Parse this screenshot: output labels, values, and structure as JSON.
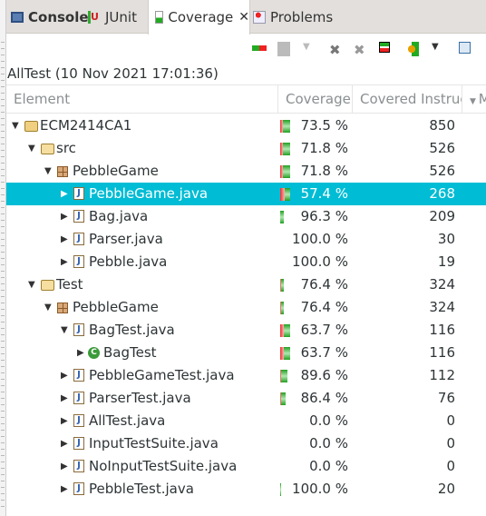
{
  "tabs": [
    {
      "label": "Console",
      "icon": "console-icon",
      "bold": true
    },
    {
      "label": "JUnit",
      "icon": "junit-icon"
    },
    {
      "label": "Coverage",
      "icon": "coverage-icon",
      "active": true,
      "closable": true
    },
    {
      "label": "Problems",
      "icon": "problems-icon"
    }
  ],
  "toolbar": [
    "link-icon",
    "merge-sessions-icon",
    "dropdown-icon",
    "remove-session-icon",
    "remove-all-sessions-icon",
    "dump-execution-data-icon",
    "coverage-run-icon",
    "view-menu-icon",
    "collapse-all-icon"
  ],
  "session_title": "AllTest (10 Nov 2021 17:01:36)",
  "columns": [
    "Element",
    "Coverage",
    "Covered Instruct",
    "Missed"
  ],
  "colors": {
    "selection": "#00bcd4",
    "covered": "#22b022",
    "missed": "#e83030"
  },
  "rows": [
    {
      "name": "ECM2414CA1",
      "type": "project",
      "level": 0,
      "expanded": true,
      "coverage": "73.5 %",
      "covered": "850",
      "pct": 73.5,
      "bar": 1
    },
    {
      "name": "src",
      "type": "source-folder",
      "level": 1,
      "expanded": true,
      "coverage": "71.8 %",
      "covered": "526",
      "pct": 71.8,
      "bar": 1
    },
    {
      "name": "PebbleGame",
      "type": "package",
      "level": 2,
      "expanded": true,
      "coverage": "71.8 %",
      "covered": "526",
      "pct": 71.8,
      "bar": 1
    },
    {
      "name": "PebbleGame.java",
      "type": "java-file",
      "level": 3,
      "expanded": false,
      "coverage": "57.4 %",
      "covered": "268",
      "pct": 57.4,
      "bar": 1,
      "selected": true
    },
    {
      "name": "Bag.java",
      "type": "java-file",
      "level": 3,
      "expanded": false,
      "coverage": "96.3 %",
      "covered": "209",
      "pct": 96.3,
      "bar": 0.4
    },
    {
      "name": "Parser.java",
      "type": "java-file",
      "level": 3,
      "expanded": false,
      "coverage": "100.0 %",
      "covered": "30",
      "pct": 100,
      "bar": 0
    },
    {
      "name": "Pebble.java",
      "type": "java-file",
      "level": 3,
      "expanded": false,
      "coverage": "100.0 %",
      "covered": "19",
      "pct": 100,
      "bar": 0
    },
    {
      "name": "Test",
      "type": "source-folder",
      "level": 1,
      "expanded": true,
      "coverage": "76.4 %",
      "covered": "324",
      "pct": 76.4,
      "bar": 0.4
    },
    {
      "name": "PebbleGame",
      "type": "package",
      "level": 2,
      "expanded": true,
      "coverage": "76.4 %",
      "covered": "324",
      "pct": 76.4,
      "bar": 0.4
    },
    {
      "name": "BagTest.java",
      "type": "java-file",
      "level": 3,
      "expanded": true,
      "coverage": "63.7 %",
      "covered": "116",
      "pct": 63.7,
      "bar": 1
    },
    {
      "name": "BagTest",
      "type": "class",
      "level": 4,
      "expanded": false,
      "coverage": "63.7 %",
      "covered": "116",
      "pct": 63.7,
      "bar": 1
    },
    {
      "name": "PebbleGameTest.java",
      "type": "java-file",
      "level": 3,
      "expanded": false,
      "coverage": "89.6 %",
      "covered": "112",
      "pct": 89.6,
      "bar": 0.7
    },
    {
      "name": "ParserTest.java",
      "type": "java-file",
      "level": 3,
      "expanded": false,
      "coverage": "86.4 %",
      "covered": "76",
      "pct": 86.4,
      "bar": 0.5
    },
    {
      "name": "AllTest.java",
      "type": "java-file",
      "level": 3,
      "expanded": false,
      "coverage": "0.0 %",
      "covered": "0",
      "pct": 0,
      "bar": 0
    },
    {
      "name": "InputTestSuite.java",
      "type": "java-file",
      "level": 3,
      "expanded": false,
      "coverage": "0.0 %",
      "covered": "0",
      "pct": 0,
      "bar": 0
    },
    {
      "name": "NoInputTestSuite.java",
      "type": "java-file",
      "level": 3,
      "expanded": false,
      "coverage": "0.0 %",
      "covered": "0",
      "pct": 0,
      "bar": 0
    },
    {
      "name": "PebbleTest.java",
      "type": "java-file",
      "level": 3,
      "expanded": false,
      "coverage": "100.0 %",
      "covered": "20",
      "pct": 100,
      "bar": 0.1
    }
  ]
}
